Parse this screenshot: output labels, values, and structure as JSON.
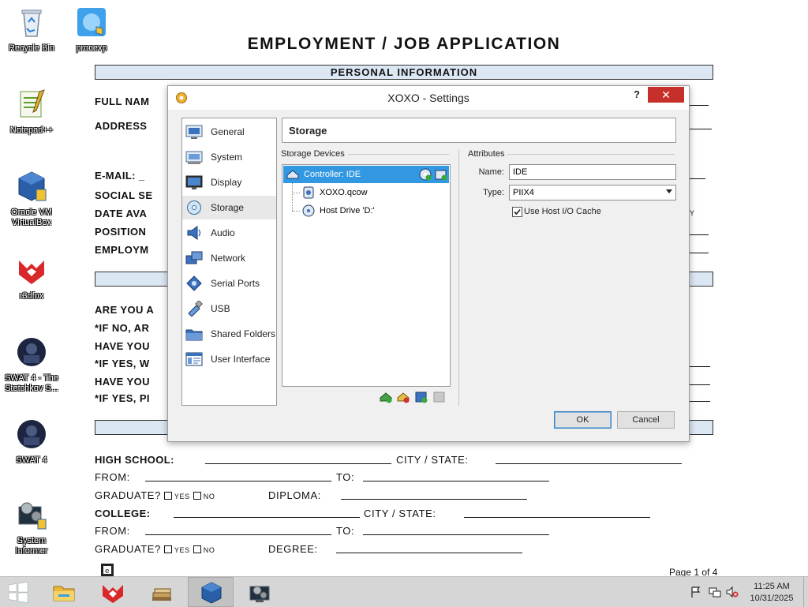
{
  "document": {
    "title": "EMPLOYMENT / JOB APPLICATION",
    "section_personal": "PERSONAL INFORMATION",
    "labels": {
      "full_name": "FULL NAM",
      "address": "ADDRESS",
      "email": "E-MAIL: _",
      "social": "SOCIAL SE",
      "date_available": "DATE AVA",
      "position": "POSITION",
      "employment": "EMPLOYM",
      "are_you": "ARE YOU A",
      "if_no": "*IF NO, AR",
      "have_you_1": "HAVE YOU",
      "if_yes_w": "*IF YES, W",
      "have_you_2": "HAVE YOU",
      "if_yes_p": "*IF YES, PI"
    },
    "right_fragment": "Y",
    "education": {
      "high_school": "HIGH SCHOOL:",
      "city_state_1": "CITY / STATE:",
      "from_1": "FROM:",
      "to_1": "TO:",
      "graduate_1": "GRADUATE?",
      "yes_1": "YES",
      "no_1": "NO",
      "diploma": "DIPLOMA:",
      "college": "COLLEGE:",
      "city_state_2": "CITY / STATE:",
      "from_2": "FROM:",
      "to_2": "TO:",
      "graduate_2": "GRADUATE?",
      "yes_2": "YES",
      "no_2": "NO",
      "degree": "DEGREE:"
    },
    "page_number": "Page 1 of 4"
  },
  "desktop_icons": [
    {
      "label": "Recycle Bin",
      "icon": "recycle-bin-icon"
    },
    {
      "label": "procexp",
      "icon": "procexp-icon"
    },
    {
      "label": "Notepad++",
      "icon": "notepad-plus-plus-icon"
    },
    {
      "label": "Oracle VM VirtualBox",
      "icon": "virtualbox-icon"
    },
    {
      "label": "r3dfox",
      "icon": "r3dfox-icon"
    },
    {
      "label": "SWAT 4 - The Stetchkov S...",
      "icon": "swat4-expansion-icon"
    },
    {
      "label": "SWAT 4",
      "icon": "swat4-icon"
    },
    {
      "label": "System Informer",
      "icon": "system-informer-icon"
    }
  ],
  "dialog": {
    "title": "XOXO - Settings",
    "help": "?",
    "close": "✕",
    "categories": [
      {
        "label": "General",
        "icon": "general-icon"
      },
      {
        "label": "System",
        "icon": "system-icon"
      },
      {
        "label": "Display",
        "icon": "display-icon"
      },
      {
        "label": "Storage",
        "icon": "storage-icon",
        "selected": true
      },
      {
        "label": "Audio",
        "icon": "audio-icon"
      },
      {
        "label": "Network",
        "icon": "network-icon"
      },
      {
        "label": "Serial Ports",
        "icon": "serial-ports-icon"
      },
      {
        "label": "USB",
        "icon": "usb-icon"
      },
      {
        "label": "Shared Folders",
        "icon": "shared-folders-icon"
      },
      {
        "label": "User Interface",
        "icon": "user-interface-icon"
      }
    ],
    "pane_title": "Storage",
    "storage_devices_label": "Storage Devices",
    "attributes_label": "Attributes",
    "tree": {
      "controller": "Controller: IDE",
      "disk": "XOXO.qcow",
      "optical": "Host Drive 'D:'"
    },
    "attributes": {
      "name_label": "Name:",
      "name_value": "IDE",
      "type_label": "Type:",
      "type_value": "PIIX4",
      "io_cache_label": "Use Host I/O Cache",
      "io_cache_checked": true
    },
    "buttons": {
      "ok": "OK",
      "cancel": "Cancel"
    }
  },
  "taskbar": {
    "items": [
      {
        "name": "start",
        "icon": "windows-start-icon"
      },
      {
        "name": "file-explorer",
        "icon": "file-explorer-icon"
      },
      {
        "name": "r3dfox",
        "icon": "r3dfox-icon"
      },
      {
        "name": "books",
        "icon": "books-icon"
      },
      {
        "name": "virtualbox",
        "icon": "virtualbox-icon",
        "active": true
      },
      {
        "name": "system-informer",
        "icon": "system-informer-icon"
      }
    ],
    "time": "11:25 AM",
    "date": "10/31/2025"
  }
}
